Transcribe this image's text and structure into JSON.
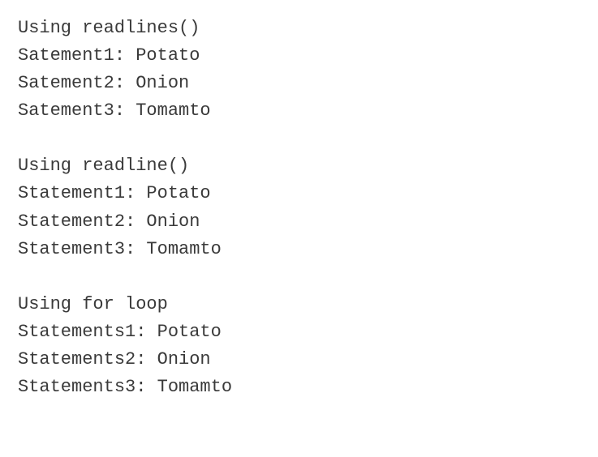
{
  "blocks": [
    {
      "header": "Using readlines()",
      "lines": [
        "Satement1: Potato",
        "Satement2: Onion",
        "Satement3: Tomamto"
      ]
    },
    {
      "header": "Using readline()",
      "lines": [
        "Statement1: Potato",
        "Statement2: Onion",
        "Statement3: Tomamto"
      ]
    },
    {
      "header": "Using for loop",
      "lines": [
        "Statements1: Potato",
        "Statements2: Onion",
        "Statements3: Tomamto"
      ]
    }
  ]
}
